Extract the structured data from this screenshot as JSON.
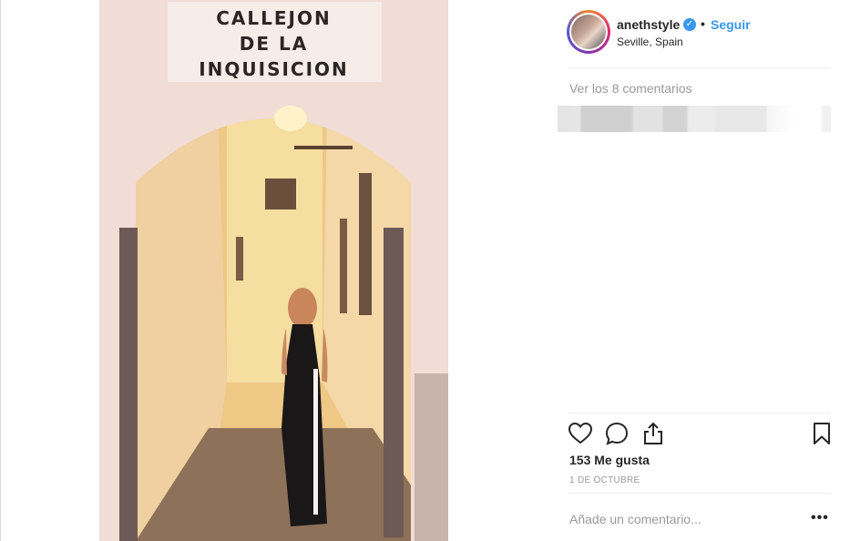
{
  "post": {
    "sign": {
      "line1": "CALLEJON",
      "line2": "DE LA",
      "line3": "INQUISICION"
    }
  },
  "header": {
    "username": "anethstyle",
    "separator": "•",
    "follow_label": "Seguir",
    "location": "Seville, Spain",
    "verified_icon": "verified-badge-icon"
  },
  "comments": {
    "view_all_label": "Ver los 8 comentarios"
  },
  "actions": {
    "icons": [
      "heart-icon",
      "comment-icon",
      "share-icon",
      "bookmark-icon"
    ],
    "likes_label": "153 Me gusta",
    "date_label": "1 DE OCTUBRE"
  },
  "add_comment": {
    "placeholder": "Añade un comentario...",
    "more_label": "•••"
  },
  "colors": {
    "link": "#3897f0",
    "text": "#262626",
    "muted": "#999999",
    "divider": "#efefef"
  }
}
